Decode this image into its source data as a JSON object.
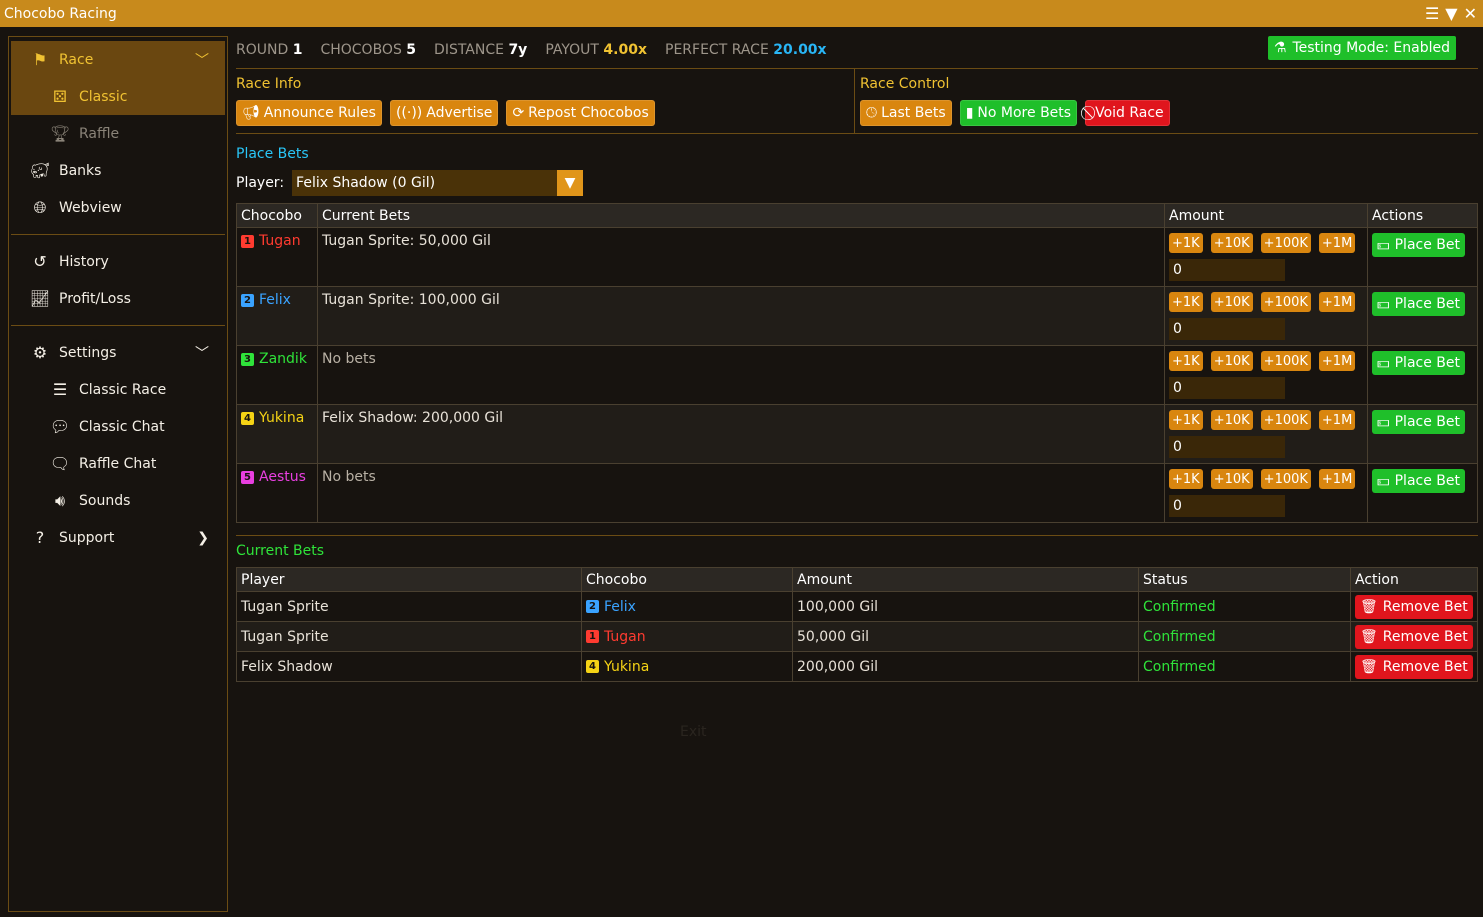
{
  "window": {
    "title": "Chocobo Racing"
  },
  "colors": {
    "accent": "#c88a1c",
    "gold": "#f0c232",
    "green": "#1fbf2a",
    "red": "#e0151d",
    "cyan": "#29c5f6",
    "orange": "#d9860f"
  },
  "sidebar": {
    "race": {
      "label": "Race",
      "icon": "flag-icon"
    },
    "classic": {
      "label": "Classic",
      "icon": "dice-icon"
    },
    "raffle": {
      "label": "Raffle",
      "icon": "trophy-icon"
    },
    "banks": {
      "label": "Banks",
      "icon": "piggy-bank-icon"
    },
    "webview": {
      "label": "Webview",
      "icon": "globe-icon"
    },
    "history": {
      "label": "History",
      "icon": "history-icon"
    },
    "profitloss": {
      "label": "Profit/Loss",
      "icon": "chart-line-icon"
    },
    "settings": {
      "label": "Settings",
      "icon": "gear-icon"
    },
    "classic_race": {
      "label": "Classic Race",
      "icon": "sliders-icon"
    },
    "classic_chat": {
      "label": "Classic Chat",
      "icon": "chat-icon"
    },
    "raffle_chat": {
      "label": "Raffle Chat",
      "icon": "chats-icon"
    },
    "sounds": {
      "label": "Sounds",
      "icon": "speaker-icon"
    },
    "support": {
      "label": "Support",
      "icon": "question-icon"
    }
  },
  "stats": {
    "round_label": "ROUND",
    "round": "1",
    "chocobos_label": "CHOCOBOS",
    "chocobos": "5",
    "distance_label": "DISTANCE",
    "distance": "7y",
    "payout_label": "PAYOUT",
    "payout": "4.00x",
    "perfect_label": "PERFECT RACE",
    "perfect": "20.00x"
  },
  "testing_mode": "Testing Mode: Enabled",
  "race_info": {
    "title": "Race Info",
    "announce": "Announce Rules",
    "advertise": "Advertise",
    "repost": "Repost Chocobos"
  },
  "race_control": {
    "title": "Race Control",
    "last_bets": "Last Bets",
    "no_more_bets": "No More Bets",
    "void_race": "Void Race"
  },
  "place_bets": {
    "title": "Place Bets",
    "player_label": "Player:",
    "player_value": "Felix Shadow (0 Gil)",
    "columns": {
      "chocobo": "Chocobo",
      "current": "Current Bets",
      "amount": "Amount",
      "actions": "Actions"
    },
    "amount_buttons": [
      "+1K",
      "+10K",
      "+100K",
      "+1M"
    ],
    "place_label": "Place Bet",
    "rows": [
      {
        "num": "1",
        "name": "Tugan",
        "color": "#ff3b30",
        "bets": "Tugan Sprite: 50,000 Gil",
        "amount": "0"
      },
      {
        "num": "2",
        "name": "Felix",
        "color": "#3aa3ff",
        "bets": "Tugan Sprite: 100,000 Gil",
        "amount": "0"
      },
      {
        "num": "3",
        "name": "Zandik",
        "color": "#2fe33a",
        "bets": "No bets",
        "amount": "0"
      },
      {
        "num": "4",
        "name": "Yukina",
        "color": "#f5d315",
        "bets": "Felix Shadow: 200,000 Gil",
        "amount": "0"
      },
      {
        "num": "5",
        "name": "Aestus",
        "color": "#e83fe0",
        "bets": "No bets",
        "amount": "0"
      }
    ]
  },
  "current_bets": {
    "title": "Current Bets",
    "columns": {
      "player": "Player",
      "chocobo": "Chocobo",
      "amount": "Amount",
      "status": "Status",
      "action": "Action"
    },
    "remove_label": "Remove Bet",
    "rows": [
      {
        "player": "Tugan Sprite",
        "num": "2",
        "chocobo": "Felix",
        "color": "#3aa3ff",
        "amount": "100,000 Gil",
        "status": "Confirmed"
      },
      {
        "player": "Tugan Sprite",
        "num": "1",
        "chocobo": "Tugan",
        "color": "#ff3b30",
        "amount": "50,000 Gil",
        "status": "Confirmed"
      },
      {
        "player": "Felix Shadow",
        "num": "4",
        "chocobo": "Yukina",
        "color": "#f5d315",
        "amount": "200,000 Gil",
        "status": "Confirmed"
      }
    ]
  },
  "ghost_exit": "Exit"
}
